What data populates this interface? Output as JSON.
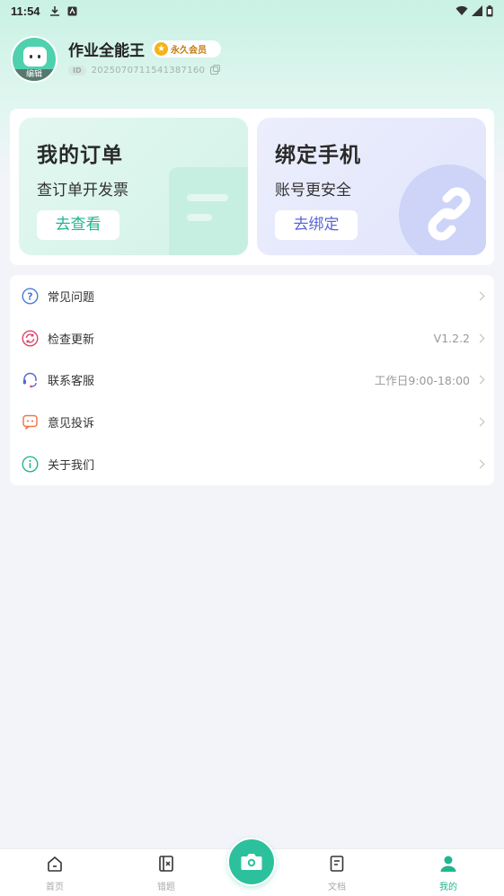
{
  "status_bar": {
    "time": "11:54"
  },
  "profile": {
    "username": "作业全能王",
    "vip_label": "永久会员",
    "id_tag": "ID",
    "id_value": "20250707115413871​60",
    "avatar_edit": "编辑"
  },
  "cards": {
    "order": {
      "title": "我的订单",
      "subtitle": "查订单开发票",
      "button": "去查看"
    },
    "phone": {
      "title": "绑定手机",
      "subtitle": "账号更安全",
      "button": "去绑定"
    }
  },
  "menu": [
    {
      "label": "常见问题",
      "value": "",
      "icon": "question-icon",
      "color": "#4a7bd8"
    },
    {
      "label": "检查更新",
      "value": "V1.2.2",
      "icon": "refresh-icon",
      "color": "#e0436b"
    },
    {
      "label": "联系客服",
      "value": "工作日9:00-18:00",
      "icon": "headset-icon",
      "color": "#5a66d6"
    },
    {
      "label": "意见投诉",
      "value": "",
      "icon": "feedback-icon",
      "color": "#f07a4a"
    },
    {
      "label": "关于我们",
      "value": "",
      "icon": "info-icon",
      "color": "#22b58f"
    }
  ],
  "nav": {
    "home": "首页",
    "mistakes": "错题",
    "docs": "文档",
    "mine": "我的"
  },
  "colors": {
    "accent": "#2cc19c",
    "background": "#f3f4fa"
  }
}
